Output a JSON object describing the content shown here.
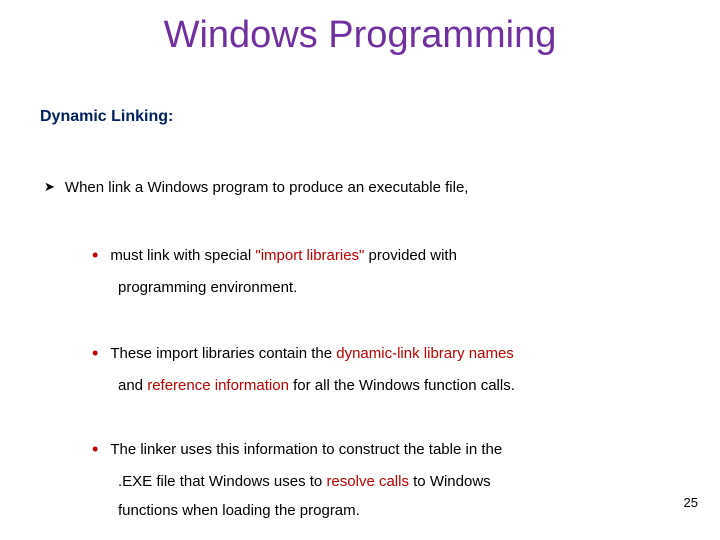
{
  "title": "Windows Programming",
  "subtitle": "Dynamic Linking:",
  "top_bullet_text": "When link a Windows program to produce an executable file,",
  "sub": {
    "a": {
      "pre": "must link with special ",
      "hl": "\"import libraries\"",
      "post": " provided with",
      "line2": "programming environment."
    },
    "b": {
      "pre": "These import libraries contain the ",
      "hl": "dynamic-link library names",
      "line2_pre": "and ",
      "line2_hl": "reference information",
      "line2_post": " for all the Windows function calls."
    },
    "c": {
      "line1": "The linker uses this information to construct the table in the",
      "line2_pre": ".EXE file that Windows uses to ",
      "line2_hl": "resolve calls",
      "line2_post": " to Windows",
      "line3": "functions when loading the program."
    }
  },
  "page_number": "25"
}
